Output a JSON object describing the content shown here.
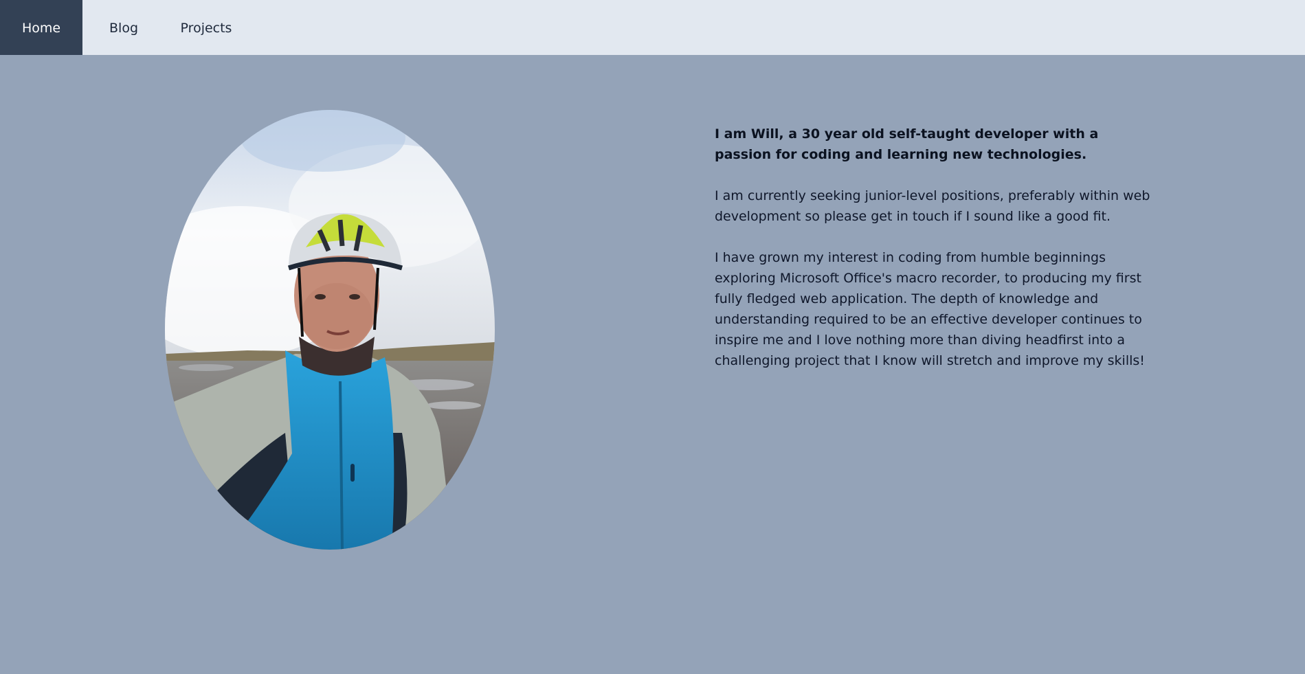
{
  "nav": {
    "items": [
      {
        "label": "Home",
        "active": true
      },
      {
        "label": "Blog",
        "active": false
      },
      {
        "label": "Projects",
        "active": false
      }
    ]
  },
  "profile": {
    "photo_alt": "Portrait of a cyclist wearing a helmet and a blue jacket on a misty hilltop"
  },
  "bio": {
    "intro": "I am Will, a 30 year old self-taught developer with a passion for coding and learning new technologies.",
    "seeking": "I am currently seeking junior-level positions, preferably within web development so please get in touch if I sound like a good fit.",
    "story": "I have grown my interest in coding from humble beginnings exploring Microsoft Office's macro recorder, to producing my first fully fledged web application. The depth of knowledge and understanding required to be an effective developer continues to inspire me and I love nothing more than diving headfirst into a challenging project that I know will stretch and improve my skills!"
  },
  "colors": {
    "page_background": "#94a3b8",
    "nav_background": "#e2e8f0",
    "nav_active_background": "#334155",
    "nav_active_text": "#ffffff",
    "jacket_blue": "#1b8fc8",
    "helmet_lime": "#c5dc3a"
  }
}
